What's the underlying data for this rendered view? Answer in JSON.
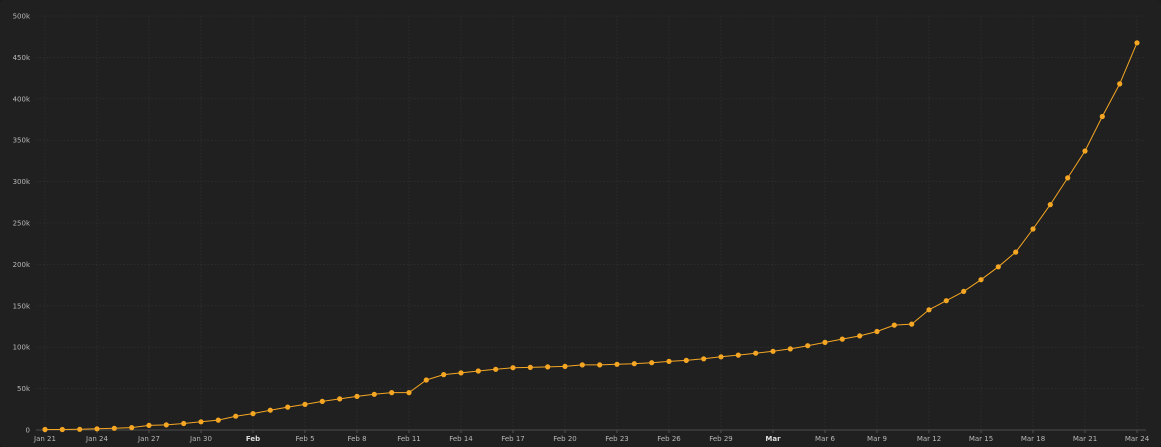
{
  "chart_data": {
    "type": "line",
    "title": "",
    "xlabel": "",
    "ylabel": "",
    "grid": true,
    "legend": "none",
    "color": "#f5a623",
    "background": "#202020",
    "ylim": [
      0,
      500000
    ],
    "y_ticks": [
      {
        "value": 0,
        "label": "0"
      },
      {
        "value": 50000,
        "label": "50k"
      },
      {
        "value": 100000,
        "label": "100k"
      },
      {
        "value": 150000,
        "label": "150k"
      },
      {
        "value": 200000,
        "label": "200k"
      },
      {
        "value": 250000,
        "label": "250k"
      },
      {
        "value": 300000,
        "label": "300k"
      },
      {
        "value": 350000,
        "label": "350k"
      },
      {
        "value": 400000,
        "label": "400k"
      },
      {
        "value": 450000,
        "label": "450k"
      },
      {
        "value": 500000,
        "label": "500k"
      }
    ],
    "x_ticks": [
      {
        "date": "2020-01-21",
        "label": "Jan 21",
        "bold": false
      },
      {
        "date": "2020-01-24",
        "label": "Jan 24",
        "bold": false
      },
      {
        "date": "2020-01-27",
        "label": "Jan 27",
        "bold": false
      },
      {
        "date": "2020-01-30",
        "label": "Jan 30",
        "bold": false
      },
      {
        "date": "2020-02-02",
        "label": "Feb",
        "bold": true
      },
      {
        "date": "2020-02-05",
        "label": "Feb 5",
        "bold": false
      },
      {
        "date": "2020-02-08",
        "label": "Feb 8",
        "bold": false
      },
      {
        "date": "2020-02-11",
        "label": "Feb 11",
        "bold": false
      },
      {
        "date": "2020-02-14",
        "label": "Feb 14",
        "bold": false
      },
      {
        "date": "2020-02-17",
        "label": "Feb 17",
        "bold": false
      },
      {
        "date": "2020-02-20",
        "label": "Feb 20",
        "bold": false
      },
      {
        "date": "2020-02-23",
        "label": "Feb 23",
        "bold": false
      },
      {
        "date": "2020-02-26",
        "label": "Feb 26",
        "bold": false
      },
      {
        "date": "2020-02-29",
        "label": "Feb 29",
        "bold": false
      },
      {
        "date": "2020-03-03",
        "label": "Mar",
        "bold": true
      },
      {
        "date": "2020-03-06",
        "label": "Mar 6",
        "bold": false
      },
      {
        "date": "2020-03-09",
        "label": "Mar 9",
        "bold": false
      },
      {
        "date": "2020-03-12",
        "label": "Mar 12",
        "bold": false
      },
      {
        "date": "2020-03-15",
        "label": "Mar 15",
        "bold": false
      },
      {
        "date": "2020-03-18",
        "label": "Mar 18",
        "bold": false
      },
      {
        "date": "2020-03-21",
        "label": "Mar 21",
        "bold": false
      },
      {
        "date": "2020-03-24",
        "label": "Mar 24",
        "bold": false
      }
    ],
    "x_start": "2020-01-21",
    "x_end": "2020-03-24",
    "series": [
      {
        "x": [
          "2020-01-21",
          "2020-01-22",
          "2020-01-23",
          "2020-01-24",
          "2020-01-25",
          "2020-01-26",
          "2020-01-27",
          "2020-01-28",
          "2020-01-29",
          "2020-01-30",
          "2020-01-31",
          "2020-02-01",
          "2020-02-02",
          "2020-02-03",
          "2020-02-04",
          "2020-02-05",
          "2020-02-06",
          "2020-02-07",
          "2020-02-08",
          "2020-02-09",
          "2020-02-10",
          "2020-02-11",
          "2020-02-12",
          "2020-02-13",
          "2020-02-14",
          "2020-02-15",
          "2020-02-16",
          "2020-02-17",
          "2020-02-18",
          "2020-02-19",
          "2020-02-20",
          "2020-02-21",
          "2020-02-22",
          "2020-02-23",
          "2020-02-24",
          "2020-02-25",
          "2020-02-26",
          "2020-02-27",
          "2020-02-28",
          "2020-02-29",
          "2020-03-01",
          "2020-03-02",
          "2020-03-03",
          "2020-03-04",
          "2020-03-05",
          "2020-03-06",
          "2020-03-07",
          "2020-03-08",
          "2020-03-09",
          "2020-03-10",
          "2020-03-11",
          "2020-03-12",
          "2020-03-13",
          "2020-03-14",
          "2020-03-15",
          "2020-03-16",
          "2020-03-17",
          "2020-03-18",
          "2020-03-19",
          "2020-03-20",
          "2020-03-21",
          "2020-03-22",
          "2020-03-23",
          "2020-03-24"
        ],
        "values": [
          550,
          650,
          900,
          1400,
          2100,
          2900,
          5600,
          6100,
          7800,
          9900,
          12000,
          16700,
          19800,
          23900,
          27600,
          30900,
          34600,
          37600,
          40600,
          43100,
          45200,
          45200,
          60400,
          66900,
          69000,
          71200,
          73300,
          75200,
          75600,
          76200,
          76800,
          78600,
          78600,
          79400,
          80100,
          81300,
          82800,
          84100,
          86000,
          88400,
          90500,
          92800,
          95100,
          97900,
          101800,
          105800,
          109800,
          113600,
          119000,
          126700,
          127900,
          145200,
          156100,
          167400,
          181500,
          197100,
          214900,
          242700,
          272200,
          304500,
          336900,
          378600,
          418000,
          467600
        ]
      }
    ]
  }
}
